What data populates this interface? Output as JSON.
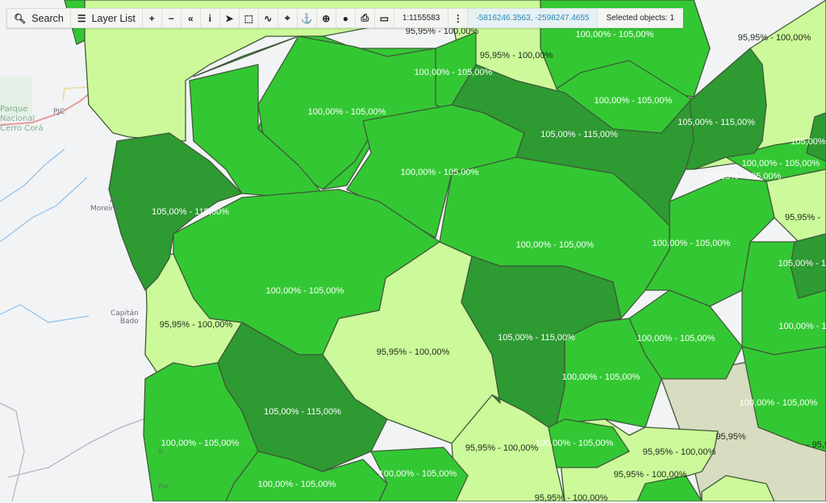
{
  "toolbar": {
    "search_label": "Search",
    "layer_list_label": "Layer List",
    "tools": [
      {
        "name": "zoom-in-icon",
        "glyph": "+"
      },
      {
        "name": "zoom-out-icon",
        "glyph": "−"
      },
      {
        "name": "collapse-icon",
        "glyph": "«"
      },
      {
        "name": "info-icon",
        "glyph": "i"
      },
      {
        "name": "select-pointer-icon",
        "glyph": "➤"
      },
      {
        "name": "box-select-icon",
        "glyph": "⬚"
      },
      {
        "name": "measure-icon",
        "glyph": "∿"
      },
      {
        "name": "locate-icon",
        "glyph": "⌖"
      },
      {
        "name": "pin-icon",
        "glyph": "⚓"
      },
      {
        "name": "magnify-icon",
        "glyph": "⊕"
      },
      {
        "name": "globe-icon",
        "glyph": "●"
      },
      {
        "name": "print-icon",
        "glyph": "⎙"
      },
      {
        "name": "scale-bar-icon",
        "glyph": "▭"
      }
    ],
    "scale": "1:1155583",
    "menu_glyph": "⋮",
    "coordinates": "-5816246.3563, -2598247.4655",
    "selected_objects": "Selected objects: 1"
  },
  "legend_colors": {
    "95,95% - 100,00%": "#ccf99a",
    "100,00% - 105,00%": "#33c833",
    "105,00% - 115,00%": "#2e9a32",
    "no_data": "#d8dcc0",
    "basemap": "#f2f3f5"
  },
  "places": {
    "park": "Parque\nNacional\nCerro Corá",
    "pjc": "PJC",
    "moreira": "Ar\nMoreira",
    "capitan_bado": "Capitán\nBado",
    "ita": "It",
    "para": "Par"
  },
  "labels": [
    {
      "text": "95,95% - 100,00%",
      "tone": "dark"
    },
    {
      "text": "100,00% - 105,00%",
      "tone": "light"
    },
    {
      "text": "95,95% - 100,00%",
      "tone": "dark"
    },
    {
      "text": "100,00% - 105,00%",
      "tone": "light"
    },
    {
      "text": "100,00% - 105,00%",
      "tone": "light"
    },
    {
      "text": "95,95% - 100,00%",
      "tone": "dark"
    },
    {
      "text": "100,00% - 105,00%",
      "tone": "light"
    },
    {
      "text": "105,00% - 115,00%",
      "tone": "light"
    },
    {
      "text": "105,00% - 115,00%",
      "tone": "light"
    },
    {
      "text": "105,00%",
      "tone": "light"
    },
    {
      "text": "100,00% - 105,00%",
      "tone": "light"
    },
    {
      "text": "100,00% - 105,00%",
      "tone": "light"
    },
    {
      "text": "100,00% - 105,00%",
      "tone": "light"
    },
    {
      "text": "105,00% - 115,00%",
      "tone": "light"
    },
    {
      "text": "95,95% -",
      "tone": "dark"
    },
    {
      "text": "100,00% - 105,00%",
      "tone": "light"
    },
    {
      "text": "100,00% - 105,00%",
      "tone": "light"
    },
    {
      "text": "105,00% - 115",
      "tone": "light"
    },
    {
      "text": "100,00% - 105,00%",
      "tone": "light"
    },
    {
      "text": "95,95% - 100,00%",
      "tone": "dark"
    },
    {
      "text": "95,95% - 100,00%",
      "tone": "dark"
    },
    {
      "text": "105,00% - 115,00%",
      "tone": "light"
    },
    {
      "text": "100,00% - 105,00%",
      "tone": "light"
    },
    {
      "text": "100,00% - 1",
      "tone": "light"
    },
    {
      "text": "100,00% - 105,00%",
      "tone": "light"
    },
    {
      "text": "100,00% - 105,00%",
      "tone": "light"
    },
    {
      "text": "105,00% - 115,00%",
      "tone": "light"
    },
    {
      "text": "100,00% - 105,00%",
      "tone": "light"
    },
    {
      "text": "95,95%",
      "tone": "dark"
    },
    {
      "text": "100,00% - 105,00%",
      "tone": "light"
    },
    {
      "text": "95,95% - 100,00%",
      "tone": "dark"
    },
    {
      "text": "100,00% - 105,00%",
      "tone": "light"
    },
    {
      "text": "95,95% - 100,00%",
      "tone": "dark"
    },
    {
      "text": "100,00% - 105,00%",
      "tone": "light"
    },
    {
      "text": "95,95% - 100,00%",
      "tone": "dark"
    },
    {
      "text": "95,95% - 100,00%",
      "tone": "dark"
    },
    {
      "text": "- 95,9",
      "tone": "dark"
    }
  ]
}
